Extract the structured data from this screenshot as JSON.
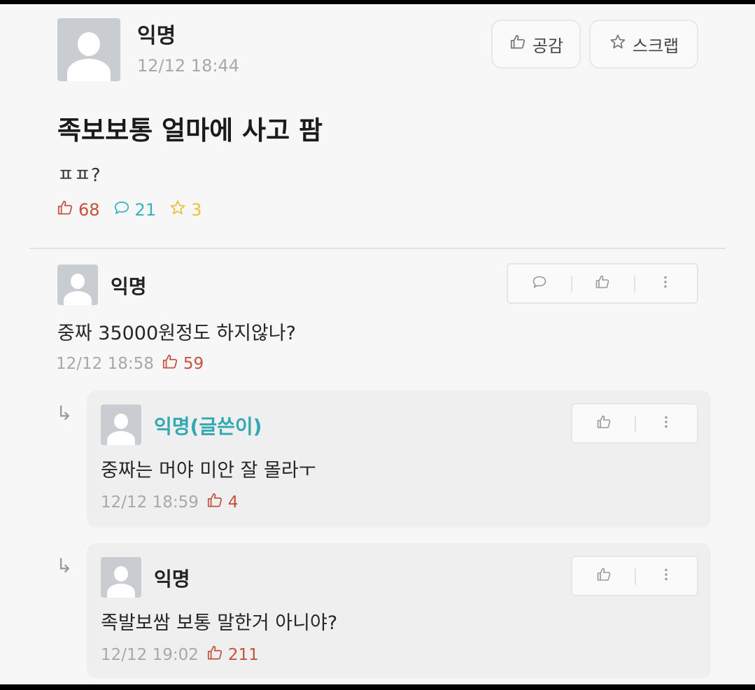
{
  "post": {
    "author": "익명",
    "time": "12/12 18:44",
    "buttons": {
      "like": "공감",
      "scrap": "스크랩"
    },
    "title": "족보보통 얼마에 사고 팜",
    "body": "ㅍㅍ?",
    "stats": {
      "likes": "68",
      "comments": "21",
      "scraps": "3"
    }
  },
  "comments": [
    {
      "author": "익명",
      "text": "중짜 35000원정도 하지않나?",
      "time": "12/12 18:58",
      "likes": "59",
      "replies": [
        {
          "author": "익명(글쓴이)",
          "is_op": true,
          "text": "중짜는 머야 미안 잘 몰라ㅜ",
          "time": "12/12 18:59",
          "likes": "4"
        },
        {
          "author": "익명",
          "is_op": false,
          "text": "족발보쌈 보통 말한거 아니야?",
          "time": "12/12 19:02",
          "likes": "211"
        }
      ]
    }
  ],
  "icons": [
    "thumbs-up-icon",
    "star-icon",
    "speech-bubble-icon",
    "more-vertical-icon",
    "reply-arrow-icon",
    "avatar-icon"
  ],
  "colors": {
    "like": "#c5513f",
    "comment": "#34b3c2",
    "scrap": "#e8c23a",
    "op_author": "#31a9b3"
  }
}
